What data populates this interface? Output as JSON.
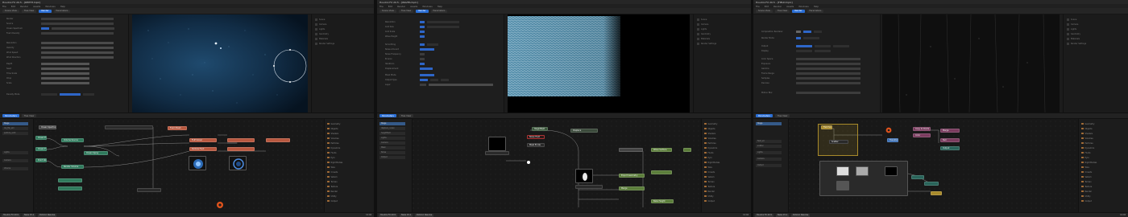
{
  "panes": [
    {
      "title": "Houdini FX 20.5 - [DEPTH.hiplc]",
      "menus": [
        "File",
        "Edit",
        "Render",
        "Assets",
        "Windows",
        "Help"
      ],
      "tabs": [
        "Scene View",
        "Tree View",
        "Render",
        "Parameters"
      ],
      "active_tab": "Render",
      "side_items": [
        "Scene",
        "Camera",
        "Lights",
        "Geometry",
        "Materials",
        "Render Settings"
      ],
      "bins": [
        "Stage",
        "obj_flip_sim",
        "particle_emit",
        "Lights",
        "Camera",
        "Volume"
      ],
      "nodes": [
        "Ocean Spectrum",
        "Ocean Evaluate",
        "Ocean Foam",
        "Point Velocity",
        "Volume Source",
        "Render Volume",
        "Ocean Spray",
        "Foam Mesh",
        "FLIP Solver",
        "Particle Fluid"
      ],
      "library": [
        "Geometry",
        "Objects",
        "Shaders",
        "Volumes",
        "Particles",
        "Dynamics",
        "Fluids",
        "Pyro",
        "Rigid Bodies",
        "Wire",
        "Crowds",
        "Vellum",
        "Terrain",
        "Texture",
        "Render",
        "Utility",
        "Output"
      ],
      "inspector_labels": [
        "Render",
        "Source",
        "Ocean Spectrum",
        "Foam Density",
        "Resolution",
        "Velocity",
        "Wind Speed",
        "Wind Direction",
        "Depth",
        "Seed",
        "Time Scale",
        "Chop",
        "Scale",
        "Density Mode"
      ],
      "taskbar": [
        "Houdini FX 20.5",
        "Nuke 15.1",
        "DaVinci Resolve"
      ],
      "clock": "12:04"
    },
    {
      "title": "Houdini FX 20.5 - [WAVES.hiplc]",
      "menus": [
        "File",
        "Edit",
        "Render",
        "Assets",
        "Windows",
        "Help"
      ],
      "tabs": [
        "Scene View",
        "Tree View",
        "Render",
        "Parameters"
      ],
      "active_tab": "Render",
      "side_items": [
        "Scene",
        "Camera",
        "Lights",
        "Geometry",
        "Materials",
        "Render Settings"
      ],
      "bins": [
        "Stage",
        "displace_ocean",
        "heightfield",
        "Lights",
        "Camera",
        "Mask",
        "Noise",
        "Output"
      ],
      "nodes": [
        "Heightfield",
        "Noise Field",
        "Mask Erode",
        "Displace",
        "Wave Surface",
        "Export Geometry",
        "Merge",
        "Bake Height"
      ],
      "library": [
        "Geometry",
        "Objects",
        "Shaders",
        "Volumes",
        "Particles",
        "Dynamics",
        "Fluids",
        "Pyro",
        "Rigid Bodies",
        "Wire",
        "Crowds",
        "Vellum",
        "Terrain",
        "Texture",
        "Render",
        "Utility",
        "Output"
      ],
      "inspector_labels": [
        "Resolution",
        "Grid Size",
        "Grid Scale",
        "Wave Height",
        "Smoothing",
        "Noise Amount",
        "Noise Frequency",
        "Erosion",
        "Iterations",
        "Displacement",
        "Mask Mode",
        "Output Type",
        "Layer"
      ],
      "taskbar": [
        "Houdini FX 20.5",
        "Nuke 15.1",
        "DaVinci Resolve"
      ],
      "clock": "12:04"
    },
    {
      "title": "Houdini FX 20.5 - [FIELD.hiplc]",
      "menus": [
        "File",
        "Edit",
        "Render",
        "Assets",
        "Windows",
        "Help"
      ],
      "tabs": [
        "Scene View",
        "Tree View",
        "Render",
        "Parameters"
      ],
      "active_tab": "Render",
      "side_items": [
        "Scene",
        "Camera",
        "Lights",
        "Geometry",
        "Materials",
        "Render Settings"
      ],
      "bins": [
        "Stage",
        "field_src",
        "scatter",
        "Lights",
        "Camera",
        "Output"
      ],
      "nodes": [
        "Field Source",
        "Scatter",
        "Transform",
        "Copy to Points",
        "Color",
        "Merge",
        "Null",
        "Output"
      ],
      "library": [
        "Geometry",
        "Objects",
        "Shaders",
        "Volumes",
        "Particles",
        "Dynamics",
        "Fluids",
        "Pyro",
        "Rigid Bodies",
        "Wire",
        "Crowds",
        "Vellum",
        "Terrain",
        "Texture",
        "Render",
        "Utility",
        "Output"
      ],
      "inspector_labels": [
        "Composition Renderer",
        "Render Mode",
        "Output",
        "Display",
        "Color Space",
        "Exposure",
        "Gamma",
        "Frame Range",
        "Samples",
        "Denoise",
        "Motion Blur"
      ],
      "taskbar": [
        "Houdini FX 20.5",
        "Nuke 15.1",
        "DaVinci Resolve"
      ],
      "clock": "12:04"
    }
  ],
  "colors": {
    "accent": "#2b6fd6",
    "node_green": "#2f7a5c",
    "node_orange": "#b8583f",
    "node_olive": "#5b7d3a",
    "alert": "#e0531c"
  }
}
